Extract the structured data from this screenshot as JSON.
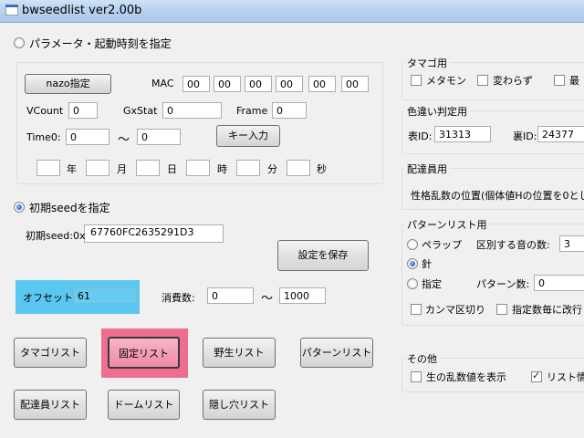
{
  "window": {
    "title": "bwseedlist ver2.00b"
  },
  "left": {
    "radio_params_label": "パラメータ・起動時刻を指定",
    "nazo_button": "nazo指定",
    "mac_label": "MAC",
    "mac_values": [
      "00",
      "00",
      "00",
      "00",
      "00",
      "00"
    ],
    "vcount_label": "VCount",
    "vcount_value": "0",
    "gxstat_label": "GxStat",
    "gxstat_value": "0",
    "frame_label": "Frame",
    "frame_value": "0",
    "time0_label": "Time0:",
    "time0_from": "0",
    "tilde": "〜",
    "time0_to": "0",
    "key_input_button": "キー入力",
    "date_units": [
      "年",
      "月",
      "日",
      "時",
      "分",
      "秒"
    ],
    "radio_seed_label": "初期seedを指定",
    "seed_label": "初期seed:0x",
    "seed_value": "67760FC2635291D3",
    "save_button": "設定を保存",
    "offset_label": "オフセット:",
    "offset_value": "61",
    "consume_label": "消費数:",
    "consume_from": "0",
    "consume_to": "1000",
    "buttons_row1": [
      "タマゴリスト",
      "固定リスト",
      "野生リスト",
      "パターンリスト"
    ],
    "buttons_row2": [
      "配達員リスト",
      "ドームリスト",
      "隠し穴リスト"
    ]
  },
  "right": {
    "egg_title": "タマゴ用",
    "egg_checks": [
      "メタモン",
      "変わらず",
      "最"
    ],
    "shiny_title": "色違い判定用",
    "front_id_label": "表ID:",
    "front_id_value": "31313",
    "back_id_label": "裏ID:",
    "back_id_value": "24377",
    "delivery_title": "配達員用",
    "delivery_text": "性格乱数の位置(個体値Hの位置を0とし",
    "pattern_title": "パターンリスト用",
    "pattern_radios": [
      "ペラップ",
      "針",
      "指定"
    ],
    "distinguish_label": "区別する音の数:",
    "distinguish_value": "3",
    "pattern_count_label": "パターン数:",
    "pattern_count_value": "0",
    "comma_check": "カンマ区切り",
    "specified_check": "指定数毎に改行",
    "other_title": "その他",
    "raw_rand_check": "生の乱数値を表示",
    "list_info_check": "リスト情報"
  },
  "colors": {
    "offset_highlight": "#5bc7f0",
    "fixed_highlight": "#ed6e8f"
  }
}
